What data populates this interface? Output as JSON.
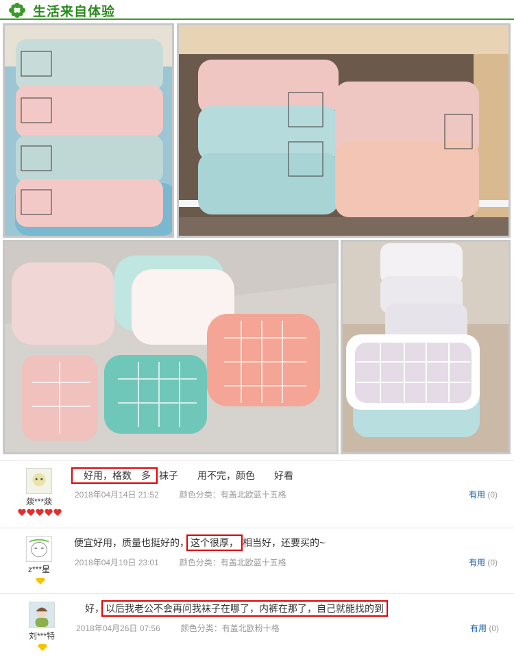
{
  "header": {
    "title": "生活来自体验",
    "logo_icon": "clover-logo-icon",
    "accent": "#2a8a1e"
  },
  "photos": [
    {
      "name": "photo-stacked-boxes-left",
      "colors": [
        "#b9d7d6",
        "#f1c6c4",
        "#ffffff"
      ]
    },
    {
      "name": "photo-boxes-in-cabinet",
      "colors": [
        "#efc2bf",
        "#a9d4d6",
        "#f0c6b5"
      ]
    },
    {
      "name": "photo-unpacked-grids",
      "colors": [
        "#f1c7c2",
        "#7fcfc3",
        "#f7a89a"
      ]
    },
    {
      "name": "photo-open-grid-box",
      "colors": [
        "#e4dde8",
        "#ffffff",
        "#b9dfe0"
      ]
    }
  ],
  "reviews": [
    {
      "user": "燚***燚",
      "level_icon": "red-heart-level-icon",
      "text_pre": "",
      "text_highlight": "好用，格数　多",
      "text_post": "袜子　　用不完，颜色　　好看",
      "date": "2018年04月14日 21:52",
      "variant": "颜色分类：有盖北欧蓝十五格",
      "useful_label": "有用",
      "useful_count": "(0)"
    },
    {
      "user": "z***星",
      "level_icon": "yellow-diamond-level-icon",
      "text_pre": "便宜好用，质量也挺好的，",
      "text_highlight": "这个很厚，",
      "text_post": "相当好，还要买的~",
      "date": "2018年04月19日 23:01",
      "variant": "颜色分类：有盖北欧蓝十五格",
      "useful_label": "有用",
      "useful_count": "(0)"
    },
    {
      "user": "刘***特",
      "level_icon": "yellow-diamond-level-icon",
      "text_pre": "好，",
      "text_highlight": "以后我老公不会再问我袜子在哪了，内裤在那了，自己就能找的到",
      "text_post": "",
      "date": "2018年04月26日 07:56",
      "variant": "颜色分类：有盖北欧粉十格",
      "useful_label": "有用",
      "useful_count": "(0)"
    }
  ]
}
